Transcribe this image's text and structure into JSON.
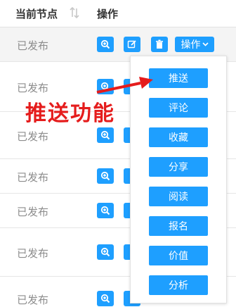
{
  "header": {
    "current_node_label": "当前节点",
    "operation_label": "操作"
  },
  "rows": [
    {
      "status": "已发布"
    },
    {
      "status": "已发布"
    },
    {
      "status": "已发布"
    },
    {
      "status": "已发布"
    },
    {
      "status": "已发布"
    },
    {
      "status": "已发布"
    },
    {
      "status": "已发布"
    }
  ],
  "operations_button": {
    "label": "操作"
  },
  "menu": {
    "items": [
      "推送",
      "评论",
      "收藏",
      "分享",
      "阅读",
      "报名",
      "价值",
      "分析"
    ]
  },
  "annotation": {
    "text": "推送功能"
  },
  "colors": {
    "button_blue": "#1e9fff",
    "annotation_red": "#e51c1c"
  }
}
